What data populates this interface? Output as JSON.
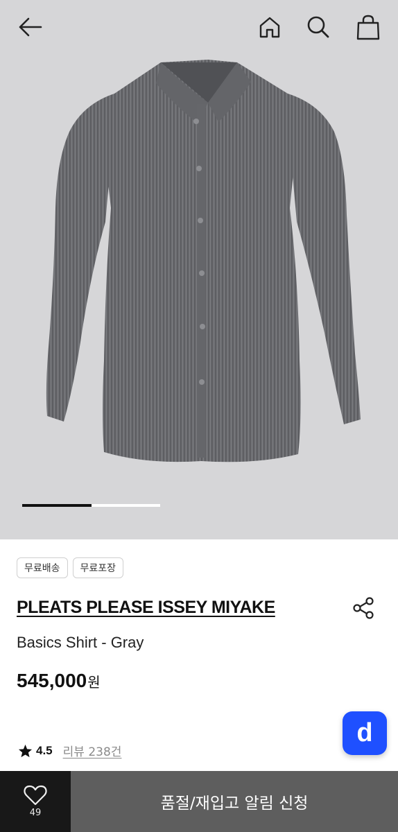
{
  "header": {
    "back_icon": "arrow-left-icon",
    "home_icon": "home-icon",
    "search_icon": "search-icon",
    "cart_icon": "shopping-bag-icon"
  },
  "gallery": {
    "image": "gray pleated shirt",
    "current_index": 1,
    "progress_fraction": 0.5
  },
  "badges": [
    "무료배송",
    "무료포장"
  ],
  "product": {
    "brand": "PLEATS PLEASE ISSEY MIYAKE",
    "name": "Basics Shirt - Gray",
    "price": "545,000",
    "price_unit": "원",
    "share_icon": "share-icon"
  },
  "rating": {
    "star_icon": "star-icon",
    "value": "4.5",
    "reviews": "리뷰 238건"
  },
  "fab": {
    "label": "d",
    "color": "#1f50ff"
  },
  "bottom_bar": {
    "like_icon": "heart-icon",
    "like_count": "49",
    "cta_label": "품절/재입고 알림 신청",
    "cta_color": "#5e5e5e"
  }
}
